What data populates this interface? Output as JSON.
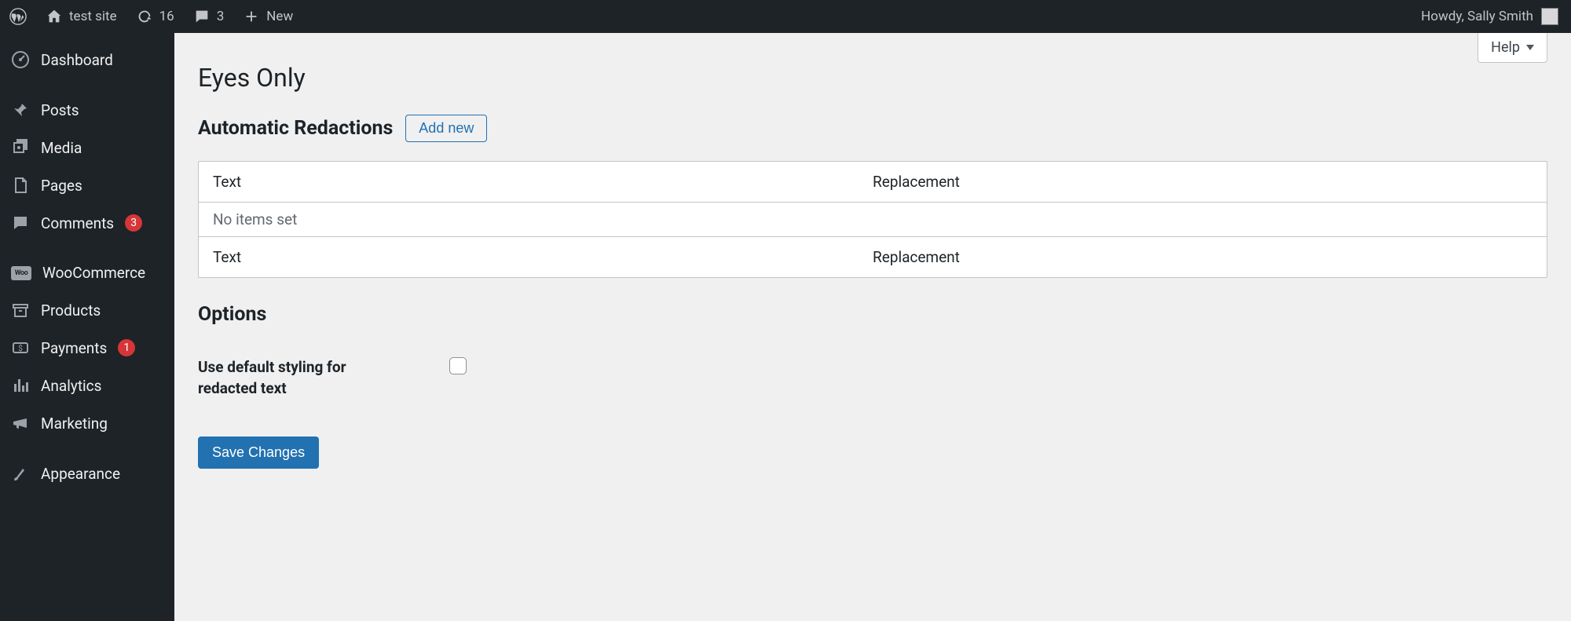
{
  "toolbar": {
    "site_name": "test site",
    "updates": "16",
    "comments": "3",
    "new_label": "New",
    "howdy": "Howdy, Sally Smith"
  },
  "sidebar": {
    "items": [
      {
        "label": "Dashboard"
      },
      {
        "label": "Posts"
      },
      {
        "label": "Media"
      },
      {
        "label": "Pages"
      },
      {
        "label": "Comments",
        "badge": "3"
      },
      {
        "label": "WooCommerce"
      },
      {
        "label": "Products"
      },
      {
        "label": "Payments",
        "badge": "1"
      },
      {
        "label": "Analytics"
      },
      {
        "label": "Marketing"
      },
      {
        "label": "Appearance"
      }
    ]
  },
  "help_label": "Help",
  "page_title": "Eyes Only",
  "redactions": {
    "heading": "Automatic Redactions",
    "add_new": "Add new",
    "col_text": "Text",
    "col_replacement": "Replacement",
    "empty": "No items set"
  },
  "options": {
    "heading": "Options",
    "default_styling_label": "Use default styling for redacted text"
  },
  "save_label": "Save Changes"
}
